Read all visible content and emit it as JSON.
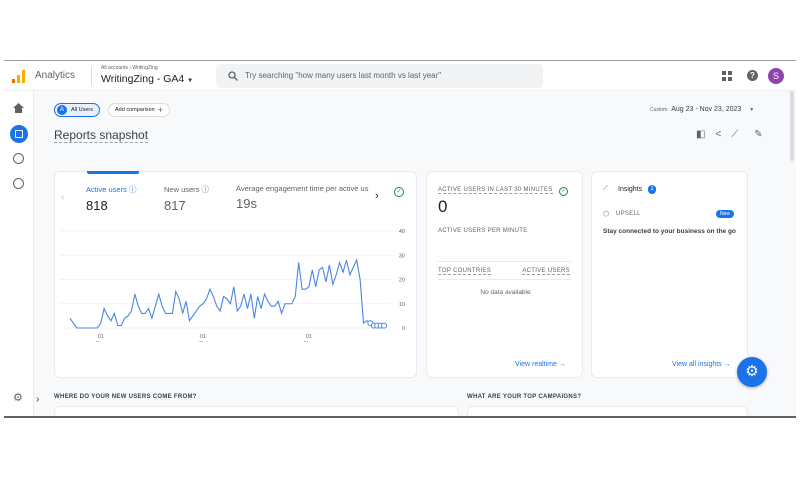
{
  "header": {
    "app_name": "Analytics",
    "breadcrumb": "All accounts › WritingZing",
    "property": "WritingZing - GA4",
    "search_placeholder": "Try searching \"how many users last month vs last year\"",
    "avatar_letter": "S"
  },
  "sidebar": {
    "items": [
      "home-icon",
      "reports-icon",
      "explore-icon",
      "advertising-icon"
    ],
    "active": "reports-icon"
  },
  "toolbar": {
    "segment_letter": "A",
    "segment": "All Users",
    "add_comparison": "Add comparison",
    "date_label": "Custom",
    "date_range": "Aug 23 - Nov 23, 2023"
  },
  "page_title": "Reports snapshot",
  "metrics": [
    {
      "label": "Active users",
      "value": "818"
    },
    {
      "label": "New users",
      "value": "817"
    },
    {
      "label": "Average engagement time per active us",
      "value": "19s"
    }
  ],
  "realtime": {
    "title": "ACTIVE USERS IN LAST 30 MINUTES",
    "value": "0",
    "per_minute": "ACTIVE USERS PER MINUTE",
    "col1": "TOP COUNTRIES",
    "col2": "ACTIVE USERS",
    "empty": "No data available",
    "link": "View realtime"
  },
  "insights": {
    "title": "Insights",
    "count": "1",
    "tag": "UPSELL",
    "badge": "New",
    "text": "Stay connected to your business on the go",
    "link": "View all insights"
  },
  "sections": {
    "new_users": "WHERE DO YOUR NEW USERS COME FROM?",
    "campaigns": "WHAT ARE YOUR TOP CAMPAIGNS?"
  },
  "colors": {
    "accent": "#1a73e8",
    "line": "#4a86e8",
    "success": "#1e8e3e"
  },
  "chart_data": {
    "type": "line",
    "x_start": "Aug 23",
    "x_end": "Nov 23",
    "x_ticks": [
      {
        "day": "01",
        "month": "Sep",
        "index": 9
      },
      {
        "day": "01",
        "month": "Oct",
        "index": 39
      },
      {
        "day": "01",
        "month": "Nov",
        "index": 70
      }
    ],
    "y_ticks": [
      0,
      10,
      20,
      30,
      40
    ],
    "ylim": [
      0,
      40
    ],
    "grid": true,
    "series": [
      {
        "values": [
          4,
          2,
          0,
          0,
          0,
          0,
          0,
          0,
          0,
          2,
          8,
          5,
          3,
          6,
          1,
          1,
          4,
          5,
          7,
          14,
          9,
          6,
          6,
          8,
          4,
          9,
          14,
          9,
          6,
          6,
          6,
          15,
          12,
          6,
          11,
          3,
          5,
          7,
          9,
          10,
          12,
          16,
          13,
          9,
          7,
          13,
          12,
          10,
          17,
          7,
          9,
          14,
          8,
          14,
          4,
          13,
          8,
          14,
          11,
          9,
          9,
          11,
          6,
          10,
          10,
          10,
          13,
          27,
          16,
          16,
          17,
          24,
          17,
          24,
          25,
          19,
          26,
          18,
          22,
          27,
          23,
          28,
          22,
          25,
          28,
          20,
          2,
          3,
          2,
          1,
          1,
          1,
          1
        ],
        "incomplete_from_index": 88
      }
    ]
  }
}
